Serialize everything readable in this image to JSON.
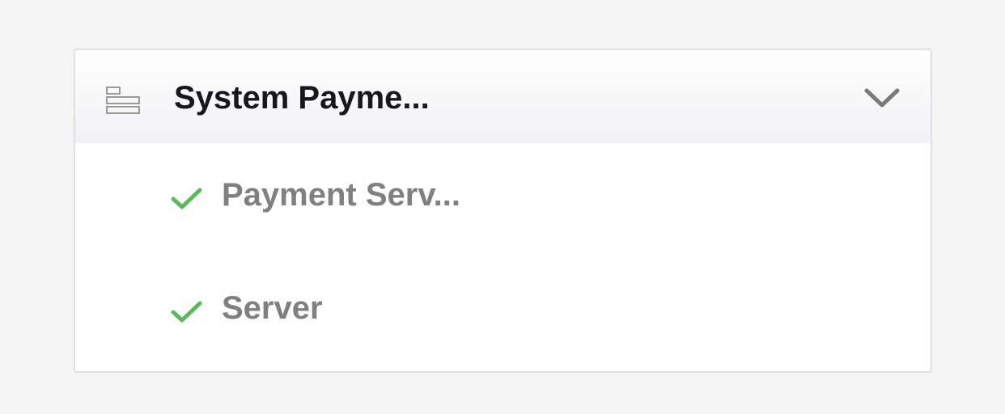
{
  "section": {
    "title": "System Payme...",
    "icon": "hierarchy-icon",
    "expanded": true,
    "toggle_icon": "chevron-down-icon"
  },
  "items": [
    {
      "label": "Payment Serv...",
      "status": "ok",
      "status_icon": "checkmark-icon"
    },
    {
      "label": "Server",
      "status": "ok",
      "status_icon": "checkmark-icon"
    }
  ],
  "colors": {
    "page_background": "#f4f4f6",
    "panel_background": "#ffffff",
    "panel_border": "#e0e0e3",
    "title_text": "#17171c",
    "item_text": "#808080",
    "check_green": "#5cb85c",
    "chevron_gray": "#7a7a7a",
    "icon_gray": "#9a9a9a"
  }
}
